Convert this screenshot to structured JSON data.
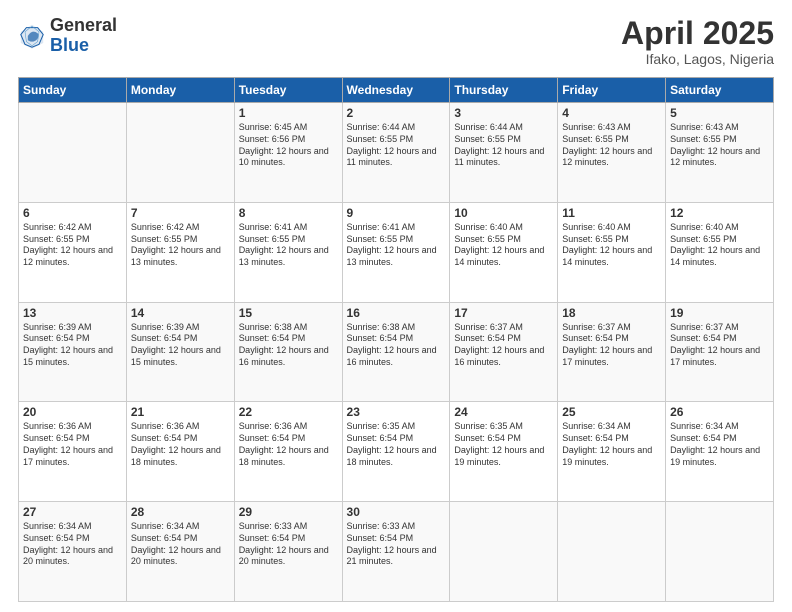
{
  "header": {
    "logo_general": "General",
    "logo_blue": "Blue",
    "month_title": "April 2025",
    "location": "Ifako, Lagos, Nigeria"
  },
  "days_of_week": [
    "Sunday",
    "Monday",
    "Tuesday",
    "Wednesday",
    "Thursday",
    "Friday",
    "Saturday"
  ],
  "weeks": [
    [
      {
        "day": "",
        "info": ""
      },
      {
        "day": "",
        "info": ""
      },
      {
        "day": "1",
        "info": "Sunrise: 6:45 AM\nSunset: 6:56 PM\nDaylight: 12 hours and 10 minutes."
      },
      {
        "day": "2",
        "info": "Sunrise: 6:44 AM\nSunset: 6:55 PM\nDaylight: 12 hours and 11 minutes."
      },
      {
        "day": "3",
        "info": "Sunrise: 6:44 AM\nSunset: 6:55 PM\nDaylight: 12 hours and 11 minutes."
      },
      {
        "day": "4",
        "info": "Sunrise: 6:43 AM\nSunset: 6:55 PM\nDaylight: 12 hours and 12 minutes."
      },
      {
        "day": "5",
        "info": "Sunrise: 6:43 AM\nSunset: 6:55 PM\nDaylight: 12 hours and 12 minutes."
      }
    ],
    [
      {
        "day": "6",
        "info": "Sunrise: 6:42 AM\nSunset: 6:55 PM\nDaylight: 12 hours and 12 minutes."
      },
      {
        "day": "7",
        "info": "Sunrise: 6:42 AM\nSunset: 6:55 PM\nDaylight: 12 hours and 13 minutes."
      },
      {
        "day": "8",
        "info": "Sunrise: 6:41 AM\nSunset: 6:55 PM\nDaylight: 12 hours and 13 minutes."
      },
      {
        "day": "9",
        "info": "Sunrise: 6:41 AM\nSunset: 6:55 PM\nDaylight: 12 hours and 13 minutes."
      },
      {
        "day": "10",
        "info": "Sunrise: 6:40 AM\nSunset: 6:55 PM\nDaylight: 12 hours and 14 minutes."
      },
      {
        "day": "11",
        "info": "Sunrise: 6:40 AM\nSunset: 6:55 PM\nDaylight: 12 hours and 14 minutes."
      },
      {
        "day": "12",
        "info": "Sunrise: 6:40 AM\nSunset: 6:55 PM\nDaylight: 12 hours and 14 minutes."
      }
    ],
    [
      {
        "day": "13",
        "info": "Sunrise: 6:39 AM\nSunset: 6:54 PM\nDaylight: 12 hours and 15 minutes."
      },
      {
        "day": "14",
        "info": "Sunrise: 6:39 AM\nSunset: 6:54 PM\nDaylight: 12 hours and 15 minutes."
      },
      {
        "day": "15",
        "info": "Sunrise: 6:38 AM\nSunset: 6:54 PM\nDaylight: 12 hours and 16 minutes."
      },
      {
        "day": "16",
        "info": "Sunrise: 6:38 AM\nSunset: 6:54 PM\nDaylight: 12 hours and 16 minutes."
      },
      {
        "day": "17",
        "info": "Sunrise: 6:37 AM\nSunset: 6:54 PM\nDaylight: 12 hours and 16 minutes."
      },
      {
        "day": "18",
        "info": "Sunrise: 6:37 AM\nSunset: 6:54 PM\nDaylight: 12 hours and 17 minutes."
      },
      {
        "day": "19",
        "info": "Sunrise: 6:37 AM\nSunset: 6:54 PM\nDaylight: 12 hours and 17 minutes."
      }
    ],
    [
      {
        "day": "20",
        "info": "Sunrise: 6:36 AM\nSunset: 6:54 PM\nDaylight: 12 hours and 17 minutes."
      },
      {
        "day": "21",
        "info": "Sunrise: 6:36 AM\nSunset: 6:54 PM\nDaylight: 12 hours and 18 minutes."
      },
      {
        "day": "22",
        "info": "Sunrise: 6:36 AM\nSunset: 6:54 PM\nDaylight: 12 hours and 18 minutes."
      },
      {
        "day": "23",
        "info": "Sunrise: 6:35 AM\nSunset: 6:54 PM\nDaylight: 12 hours and 18 minutes."
      },
      {
        "day": "24",
        "info": "Sunrise: 6:35 AM\nSunset: 6:54 PM\nDaylight: 12 hours and 19 minutes."
      },
      {
        "day": "25",
        "info": "Sunrise: 6:34 AM\nSunset: 6:54 PM\nDaylight: 12 hours and 19 minutes."
      },
      {
        "day": "26",
        "info": "Sunrise: 6:34 AM\nSunset: 6:54 PM\nDaylight: 12 hours and 19 minutes."
      }
    ],
    [
      {
        "day": "27",
        "info": "Sunrise: 6:34 AM\nSunset: 6:54 PM\nDaylight: 12 hours and 20 minutes."
      },
      {
        "day": "28",
        "info": "Sunrise: 6:34 AM\nSunset: 6:54 PM\nDaylight: 12 hours and 20 minutes."
      },
      {
        "day": "29",
        "info": "Sunrise: 6:33 AM\nSunset: 6:54 PM\nDaylight: 12 hours and 20 minutes."
      },
      {
        "day": "30",
        "info": "Sunrise: 6:33 AM\nSunset: 6:54 PM\nDaylight: 12 hours and 21 minutes."
      },
      {
        "day": "",
        "info": ""
      },
      {
        "day": "",
        "info": ""
      },
      {
        "day": "",
        "info": ""
      }
    ]
  ]
}
